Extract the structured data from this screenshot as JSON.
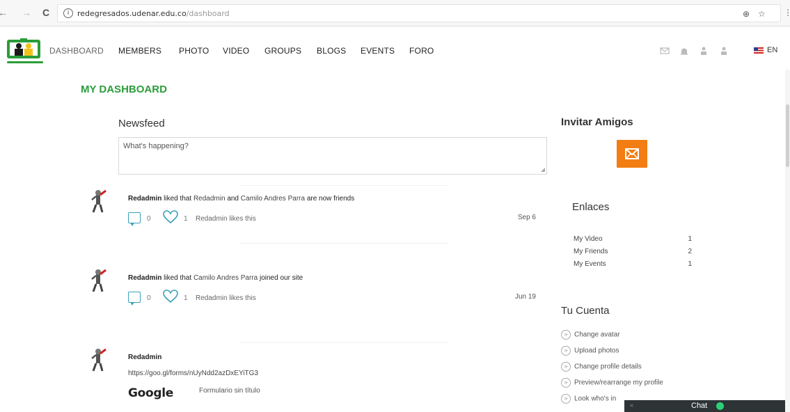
{
  "browser": {
    "url_host": "redegresados.udenar.edu.co",
    "url_path": "/dashboard",
    "back": "←",
    "forward": "→",
    "reload": "C",
    "zoom_icon": "⊕",
    "star_icon": "☆",
    "menu_icon": "⋮"
  },
  "nav": {
    "items": [
      "DASHBOARD",
      "MEMBERS",
      "PHOTO",
      "VIDEO",
      "GROUPS",
      "BLOGS",
      "EVENTS",
      "FORO"
    ],
    "lang": "EN"
  },
  "page": {
    "title": "MY DASHBOARD"
  },
  "newsfeed": {
    "title": "Newsfeed",
    "placeholder": "What's happening?",
    "items": [
      {
        "actor": "Redadmin",
        "verb": "liked that",
        "subject1": "Redadmin",
        "joiner": "and",
        "subject2": "Camilo Andres Parra",
        "tail": "are now friends",
        "comments": "0",
        "likes": "1",
        "likes_text": "Redadmin likes this",
        "date": "Sep 6"
      },
      {
        "actor": "Redadmin",
        "verb": "liked that",
        "subject1": "Camilo Andres Parra",
        "tail": "joined our site",
        "comments": "0",
        "likes": "1",
        "likes_text": "Redadmin likes this",
        "date": "Jun 19"
      },
      {
        "actor": "Redadmin",
        "url": "https://goo.gl/forms/nUyNdd2azDxEYiTG3",
        "brand": "Google",
        "form_title": "Formulario sin título"
      }
    ]
  },
  "sidebar": {
    "invite_title": "Invitar Amigos",
    "links_title": "Enlaces",
    "links": [
      {
        "label": "My Video",
        "count": "1"
      },
      {
        "label": "My Friends",
        "count": "2"
      },
      {
        "label": "My Events",
        "count": "1"
      }
    ],
    "account_title": "Tu Cuenta",
    "account": [
      "Change avatar",
      "Upload photos",
      "Change profile details",
      "Preview/rearrange my profile",
      "Look who's in"
    ]
  },
  "chat": {
    "label": "Chat",
    "close": "«"
  },
  "colors": {
    "brand_green": "#2a9d3a",
    "invite_orange": "#f27d12",
    "icon_blue": "#3a9fb8",
    "chat_online": "#2bd07b"
  }
}
